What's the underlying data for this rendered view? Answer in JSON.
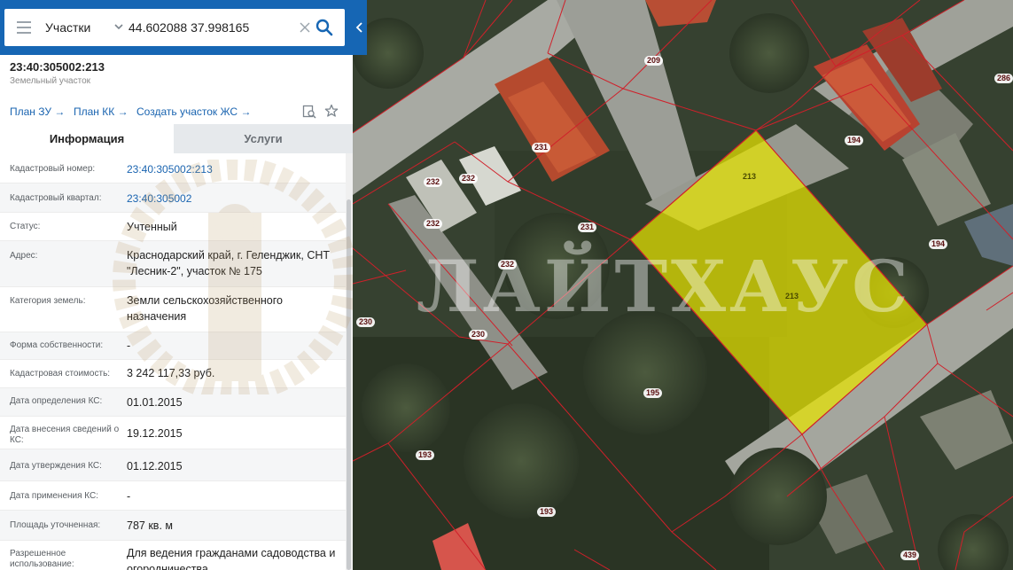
{
  "search": {
    "layer": "Участки",
    "query": "44.602088 37.998165"
  },
  "parcel": {
    "number": "23:40:305002:213",
    "type": "Земельный участок"
  },
  "links": {
    "plan_zu": "План ЗУ",
    "plan_kk": "План КК",
    "create_zs": "Создать участок ЖС"
  },
  "tabs": {
    "info": "Информация",
    "services": "Услуги"
  },
  "info_rows": [
    {
      "label": "Кадастровый номер:",
      "value": "23:40:305002:213",
      "link": true
    },
    {
      "label": "Кадастровый квартал:",
      "value": "23:40:305002",
      "link": true
    },
    {
      "label": "Статус:",
      "value": "Учтенный"
    },
    {
      "label": "Адрес:",
      "value": "Краснодарский край, г. Геленджик, СНТ \"Лесник-2\", участок № 175"
    },
    {
      "label": "Категория земель:",
      "value": "Земли сельскохозяйственного назначения"
    },
    {
      "label": "Форма собственности:",
      "value": "-"
    },
    {
      "label": "Кадастровая стоимость:",
      "value": "3 242 117,33 руб."
    },
    {
      "label": "Дата определения КС:",
      "value": "01.01.2015"
    },
    {
      "label": "Дата внесения сведений о КС:",
      "value": "19.12.2015"
    },
    {
      "label": "Дата утверждения КС:",
      "value": "01.12.2015"
    },
    {
      "label": "Дата применения КС:",
      "value": "-"
    },
    {
      "label": "Площадь уточненная:",
      "value": "787 кв. м"
    },
    {
      "label": "Разрешенное использование:",
      "value": "Для ведения гражданами садоводства и огородничества"
    }
  ],
  "map": {
    "watermark": "ЛАЙТХАУС",
    "parcel_labels": [
      "209",
      "286",
      "231",
      "194",
      "213",
      "232",
      "232",
      "232",
      "231",
      "194",
      "232",
      "213",
      "230",
      "230",
      "195",
      "193",
      "193",
      "439"
    ],
    "selected_label": "213"
  },
  "colors": {
    "header_blue": "#1666b4",
    "link_blue": "#1a64b0",
    "selected_parcel": "#e8e400",
    "boundary_red": "#d0202a"
  },
  "icons": [
    "menu-icon",
    "chevron-down-icon",
    "clear-icon",
    "search-icon",
    "collapse-left-icon",
    "arrow-right-icon",
    "zoom-document-icon",
    "star-icon"
  ]
}
